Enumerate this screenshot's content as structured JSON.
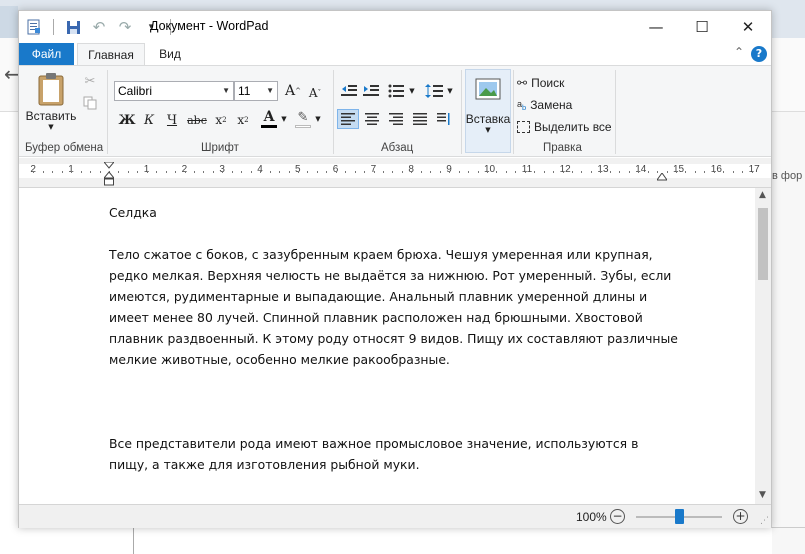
{
  "window": {
    "title": "Документ - WordPad",
    "minimize_glyph": "—",
    "maximize_glyph": "☐",
    "close_glyph": "✕"
  },
  "tabs": {
    "file": "Файл",
    "home": "Главная",
    "view": "Вид"
  },
  "ribbon": {
    "clipboard": {
      "paste": "Вставить",
      "group_label": "Буфер обмена"
    },
    "font": {
      "family": "Calibri",
      "size": "11",
      "group_label": "Шрифт"
    },
    "paragraph": {
      "group_label": "Абзац"
    },
    "insert": {
      "label": "Вставка"
    },
    "editing": {
      "find": "Поиск",
      "replace": "Замена",
      "select_all": "Выделить все",
      "group_label": "Правка"
    }
  },
  "ruler": {
    "numbers": [
      "2",
      "1",
      "1",
      "2",
      "3",
      "4",
      "5",
      "6",
      "7",
      "8",
      "9",
      "10",
      "11",
      "12",
      "13",
      "14",
      "15",
      "16",
      "17"
    ]
  },
  "document": {
    "title": "Селдка",
    "paragraph1": "Тело сжатое с боков, с зазубренным краем брюха. Чешуя умеренная или крупная, редко мелкая. Верхняя челюсть не выдаётся за нижнюю. Рот умеренный. Зубы, если имеются, рудиментарные и выпадающие. Анальный плавник умеренной длины и имеет менее 80 лучей. Спинной плавник расположен над брюшными. Хвостовой плавник раздвоенный. К этому роду относят 9 видов. Пищу их составляют различные мелкие животные, особенно мелкие ракообразные.",
    "paragraph2": "Все представители рода имеют важное промысловое значение, используются в пищу, а также для изготовления рыбной муки."
  },
  "status": {
    "zoom": "100%",
    "zoom_level_percent": 50
  },
  "background": {
    "partial_text": "в фор"
  },
  "colors": {
    "accent": "#1979ca"
  }
}
